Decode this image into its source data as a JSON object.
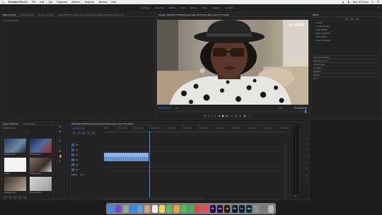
{
  "menubar": {
    "app_name": "Premiere Pro CC",
    "items": [
      "File",
      "Edit",
      "Clip",
      "Sequence",
      "Markers",
      "Graphics",
      "Window",
      "Help"
    ],
    "clock": "Mon 10:15 pm"
  },
  "workspaces": [
    "Learning",
    "Assembly",
    "Editing",
    "Color",
    "Effects",
    "Audio",
    "Graphics",
    "Libraries"
  ],
  "active_workspace": "Editing",
  "source_panel": {
    "tabs": [
      "Effect Controls",
      "Lumetri Scopes",
      "Source: (no clips)",
      "Audio Clip Mixer: Weekends of Windrush generation tell Theresa May to act..."
    ],
    "message": "(no clip selected)"
  },
  "program_monitor": {
    "title": "Program: Windrush of Windrush generation tell Theresa May to act on 'TV News'",
    "watermark": "itv NEWS",
    "timecode_left": "00:00:37:22",
    "fit": "Fit",
    "quality": "Full",
    "timecode_right": "00:03:26:00"
  },
  "effects_panel": {
    "title": "Effects",
    "items": [
      "Presets",
      "Lumetri Presets",
      "Audio Effects",
      "Audio Transitions",
      "Video Effects",
      "Video Transitions"
    ],
    "sections": [
      "Essential Graphics",
      "Essential Sound",
      "Lumetri Color",
      "Libraries",
      "Markers",
      "History",
      "Info"
    ]
  },
  "project_panel": {
    "tabs": [
      "Project: Windrush",
      "Media Browser"
    ],
    "project_file": "Windrush.prproj",
    "items": [
      "Windrush clip 1",
      "Windrush clip 2",
      "Graphic",
      "Windrush clip 3",
      "Windrush clip 4",
      "Windrush clip 5"
    ]
  },
  "timeline": {
    "sequence_tab": "Windrush of Windrush generation tell Theresa May to act on 'TV News'",
    "timecode": "00:00:37:22",
    "ruler": [
      "00:00",
      "00:00:15:00",
      "00:00:30:00",
      "00:00:45:00",
      "00:01:00:00",
      "00:01:15:00",
      "00:01:30:00",
      "00:01:45:00",
      "00:02:00:00",
      "00:02:15:00",
      "00:02:30:00",
      "00:02:45:00"
    ],
    "tracks": [
      "V3",
      "V2",
      "V1",
      "A1",
      "A2",
      "A3"
    ],
    "master": "Master",
    "master_value": "0.0"
  },
  "audio_meter": {
    "labels": [
      "0",
      "-6",
      "-12",
      "-18",
      "-24",
      "-30",
      "-36",
      "-42",
      "-48",
      "-54"
    ],
    "unit": "dB"
  },
  "colors": {
    "accent": "#3a8dff",
    "panel_bg": "#232323",
    "app_bg": "#1d1d1d",
    "video_clip": "#8db1e3",
    "audio_clip": "#6f9bd8"
  },
  "dock_icons": [
    {
      "name": "finder-icon",
      "label": "",
      "color": "#3d8bf2"
    },
    {
      "name": "siri-icon",
      "label": "",
      "color": "#6c4bd9"
    },
    {
      "name": "launchpad-icon",
      "label": "",
      "color": "#9aa3ad"
    },
    {
      "name": "safari-icon",
      "label": "",
      "color": "#2e8ef0"
    },
    {
      "name": "mail-icon",
      "label": "",
      "color": "#4aa3f2"
    },
    {
      "name": "contacts-icon",
      "label": "",
      "color": "#c9a679"
    },
    {
      "name": "calendar-icon",
      "label": "",
      "color": "#f0f0f0"
    },
    {
      "name": "notes-icon",
      "label": "",
      "color": "#f6d64a"
    },
    {
      "name": "maps-icon",
      "label": "",
      "color": "#5bbf5b"
    },
    {
      "name": "photos-icon",
      "label": "",
      "color": "#e9a23b"
    },
    {
      "name": "messages-icon",
      "label": "",
      "color": "#45c34c"
    },
    {
      "name": "facetime-icon",
      "label": "",
      "color": "#3fb34f"
    },
    {
      "name": "chrome-icon",
      "label": "",
      "color": "#e1483d"
    },
    {
      "name": "music-icon",
      "label": "",
      "color": "#f2485a"
    },
    {
      "name": "premiere-icon",
      "label": "Pr",
      "color": "#2a0a47"
    },
    {
      "name": "aftereffects-icon",
      "label": "Ae",
      "color": "#1f0c3f"
    },
    {
      "name": "illustrator-icon",
      "label": "Ai",
      "color": "#2f1500"
    },
    {
      "name": "photoshop-icon",
      "label": "Ps",
      "color": "#001d34"
    },
    {
      "name": "lightroom-icon",
      "label": "Lr",
      "color": "#0b1e32"
    },
    {
      "name": "audition-icon",
      "label": "Au",
      "color": "#00302a"
    },
    {
      "name": "preview-icon",
      "label": "",
      "color": "#8e8e8e"
    },
    {
      "name": "system-prefs-icon",
      "label": "",
      "color": "#7a7a7a"
    },
    {
      "name": "trash-icon",
      "label": "",
      "color": "#b9b9b9"
    }
  ]
}
